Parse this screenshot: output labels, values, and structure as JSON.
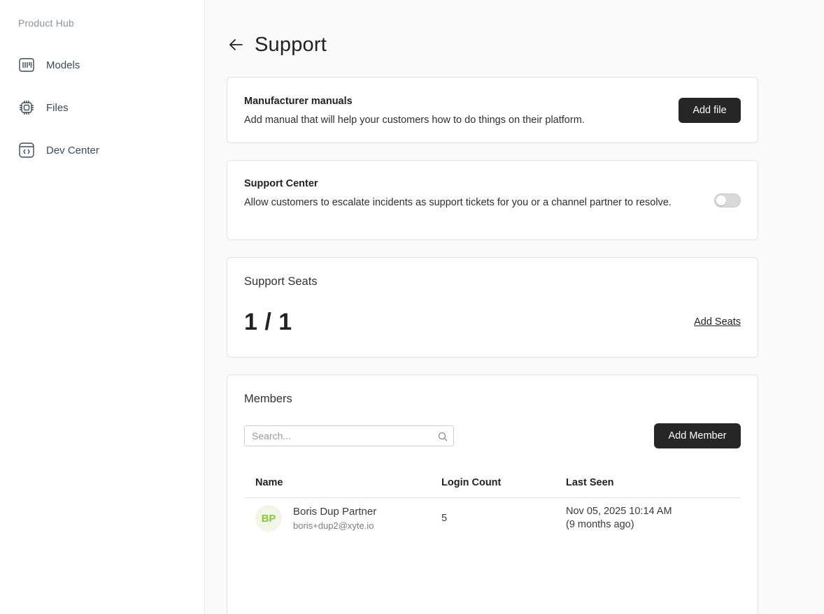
{
  "sidebar": {
    "brand": "Product Hub",
    "items": [
      {
        "label": "Models",
        "icon": "models-icon"
      },
      {
        "label": "Files",
        "icon": "chip-icon"
      },
      {
        "label": "Dev Center",
        "icon": "code-window-icon"
      }
    ]
  },
  "page": {
    "title": "Support"
  },
  "manuals": {
    "title": "Manufacturer manuals",
    "description": "Add manual that will help your customers how to do things on their platform.",
    "button": "Add file"
  },
  "support_center": {
    "title": "Support Center",
    "description": "Allow customers to escalate incidents as support tickets for you or a channel partner to resolve.",
    "enabled": false
  },
  "seats": {
    "title": "Support Seats",
    "count": "1 / 1",
    "link": "Add Seats"
  },
  "members": {
    "title": "Members",
    "search_placeholder": "Search...",
    "add_button": "Add Member",
    "columns": [
      "Name",
      "Login Count",
      "Last Seen"
    ],
    "rows": [
      {
        "initials": "BP",
        "name": "Boris Dup Partner",
        "email": "boris+dup2@xyte.io",
        "login_count": "5",
        "last_seen": "Nov 05, 2025 10:14 AM",
        "last_seen_relative": "(9 months ago)"
      }
    ]
  },
  "colors": {
    "dark_button": "#262626",
    "avatar_bg": "#f1f7e6",
    "avatar_text": "#8cc63f",
    "sidebar_text": "#3d4b55"
  }
}
